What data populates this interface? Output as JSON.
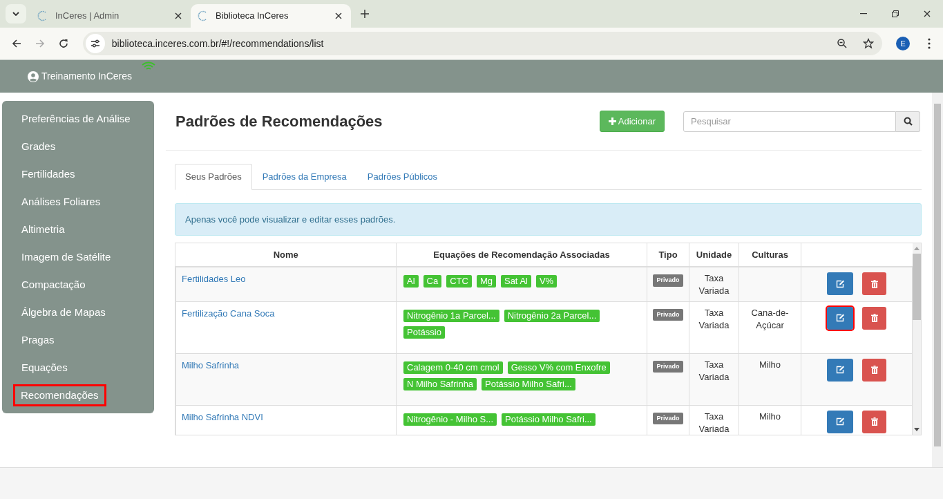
{
  "browser": {
    "tabs": [
      {
        "title": "InCeres | Admin",
        "selected": false
      },
      {
        "title": "Biblioteca InCeres",
        "selected": true
      }
    ],
    "url": "biblioteca.inceres.com.br/#!/recommendations/list",
    "forward_disabled": true,
    "profile_initial": "E"
  },
  "topbar": {
    "user": "Treinamento InCeres"
  },
  "sidebar": {
    "items": [
      {
        "label": "Preferências de Análise",
        "highlighted": false
      },
      {
        "label": "Grades",
        "highlighted": false
      },
      {
        "label": "Fertilidades",
        "highlighted": false
      },
      {
        "label": "Análises Foliares",
        "highlighted": false
      },
      {
        "label": "Altimetria",
        "highlighted": false
      },
      {
        "label": "Imagem de Satélite",
        "highlighted": false
      },
      {
        "label": "Compactação",
        "highlighted": false
      },
      {
        "label": "Álgebra de Mapas",
        "highlighted": false
      },
      {
        "label": "Pragas",
        "highlighted": false
      },
      {
        "label": "Equações",
        "highlighted": false
      },
      {
        "label": "Recomendações",
        "highlighted": true
      }
    ]
  },
  "page": {
    "title": "Padrões de Recomendações",
    "add_button": "Adicionar",
    "search": {
      "placeholder": "Pesquisar"
    },
    "tabs": [
      {
        "label": "Seus Padrões",
        "selected": true
      },
      {
        "label": "Padrões da Empresa",
        "selected": false
      },
      {
        "label": "Padrões Públicos",
        "selected": false
      }
    ],
    "info": "Apenas você pode visualizar e editar esses padrões.",
    "table": {
      "columns": [
        "Nome",
        "Equações de Recomendação Associadas",
        "Tipo",
        "Unidade",
        "Culturas"
      ],
      "rows": [
        {
          "name": "Fertilidades Leo",
          "equations": [
            "Al",
            "Ca",
            "CTC",
            "Mg",
            "Sat Al",
            "V%"
          ],
          "type": "Privado",
          "unit": [
            "Taxa",
            "Variada"
          ],
          "crops": [],
          "edit_highlighted": false
        },
        {
          "name": "Fertilização Cana Soca",
          "equations": [
            "Nitrogênio 1a Parcel...",
            "Nitrogênio 2a Parcel...",
            "Potássio"
          ],
          "type": "Privado",
          "unit": [
            "Taxa",
            "Variada"
          ],
          "crops": [
            "Cana-de-",
            "Açúcar"
          ],
          "edit_highlighted": true
        },
        {
          "name": "Milho Safrinha",
          "equations": [
            "Calagem 0-40 cm cmol",
            "Gesso V% com Enxofre",
            "N Milho Safrinha",
            "Potássio Milho Safri..."
          ],
          "type": "Privado",
          "unit": [
            "Taxa",
            "Variada"
          ],
          "crops": [
            "Milho"
          ],
          "edit_highlighted": false
        },
        {
          "name": "Milho Safrinha NDVI",
          "equations": [
            "Nitrogênio - Milho S...",
            "Potássio Milho Safri..."
          ],
          "type": "Privado",
          "unit": [
            "Taxa",
            "Variada"
          ],
          "crops": [
            "Milho"
          ],
          "edit_highlighted": false
        }
      ]
    }
  }
}
